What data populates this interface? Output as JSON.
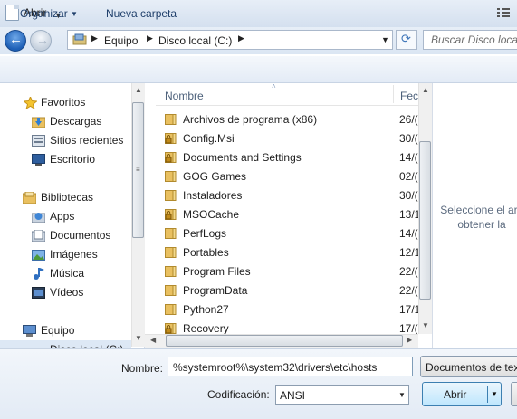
{
  "window": {
    "title": "Abrir"
  },
  "address": {
    "crumbs": [
      "Equipo",
      "Disco local (C:)"
    ]
  },
  "search": {
    "placeholder": "Buscar Disco local"
  },
  "toolbar": {
    "organize_label": "Organizar",
    "new_folder_label": "Nueva carpeta"
  },
  "nav": {
    "favorites_label": "Favoritos",
    "favorites": [
      {
        "label": "Descargas",
        "icon": "downloads-folder-icon"
      },
      {
        "label": "Sitios recientes",
        "icon": "recent-places-icon"
      },
      {
        "label": "Escritorio",
        "icon": "desktop-icon"
      }
    ],
    "libraries_label": "Bibliotecas",
    "libraries": [
      {
        "label": "Apps",
        "icon": "apps-library-icon"
      },
      {
        "label": "Documentos",
        "icon": "documents-library-icon"
      },
      {
        "label": "Imágenes",
        "icon": "pictures-library-icon"
      },
      {
        "label": "Música",
        "icon": "music-library-icon"
      },
      {
        "label": "Vídeos",
        "icon": "videos-library-icon"
      }
    ],
    "computer_label": "Equipo",
    "partial_item": "Disco local (C:)"
  },
  "filelist": {
    "col_name": "Nombre",
    "col_date": "Fec",
    "files": [
      {
        "name": "Archivos de programa (x86)",
        "date": "26/(",
        "icon": "folder-icon"
      },
      {
        "name": "Config.Msi",
        "date": "30/(",
        "icon": "locked-folder-icon"
      },
      {
        "name": "Documents and Settings",
        "date": "14/(",
        "icon": "locked-folder-icon"
      },
      {
        "name": "GOG Games",
        "date": "02/(",
        "icon": "folder-icon"
      },
      {
        "name": "Instaladores",
        "date": "30/(",
        "icon": "folder-icon"
      },
      {
        "name": "MSOCache",
        "date": "13/1",
        "icon": "locked-folder-icon"
      },
      {
        "name": "PerfLogs",
        "date": "14/(",
        "icon": "folder-icon"
      },
      {
        "name": "Portables",
        "date": "12/1",
        "icon": "folder-icon"
      },
      {
        "name": "Program Files",
        "date": "22/(",
        "icon": "folder-icon"
      },
      {
        "name": "ProgramData",
        "date": "22/(",
        "icon": "folder-icon"
      },
      {
        "name": "Python27",
        "date": "17/1",
        "icon": "folder-icon"
      },
      {
        "name": "Recovery",
        "date": "17/(",
        "icon": "locked-folder-icon"
      }
    ]
  },
  "preview": {
    "line1": "Seleccione el arc",
    "line2": "obtener la"
  },
  "bottom": {
    "filename_label": "Nombre:",
    "filename_value": "%systemroot%\\system32\\drivers\\etc\\hosts",
    "filetype_value": "Documentos de tex",
    "encoding_label": "Codificación:",
    "encoding_value": "ANSI",
    "open_label": "Abrir"
  },
  "colors": {
    "accent": "#1d5fb6",
    "folder": "#e9c060"
  }
}
